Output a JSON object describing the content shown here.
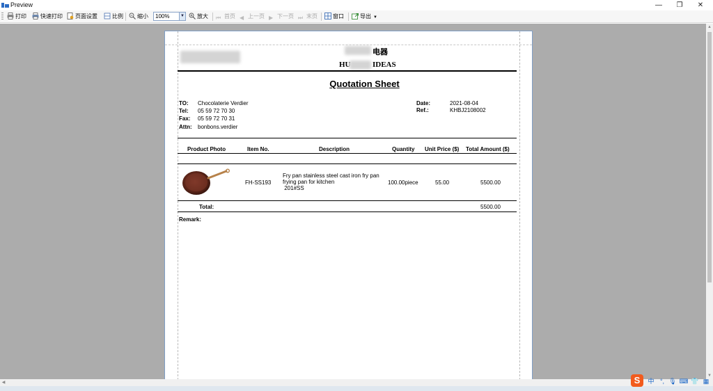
{
  "window": {
    "title": "Preview",
    "minimize_glyph": "—",
    "maximize_glyph": "❐",
    "close_glyph": "✕"
  },
  "toolbar": {
    "print": "打印",
    "quick_print": "快速打印",
    "page_setup": "页面设置",
    "ratio": "比例",
    "zoom_out": "缩小",
    "zoom_value": "100%",
    "zoom_in": "放大",
    "first_page": "首页",
    "prev_page": "上一页",
    "next_page": "下一页",
    "last_page": "末页",
    "window": "窗口",
    "export": "导出"
  },
  "document": {
    "company_cn_suffix": "电器",
    "company_en_prefix": "HU",
    "company_en_suffix": "IDEAS",
    "title": "Quotation Sheet",
    "to_label": "TO:",
    "to_value": "Chocolaterie Verdier",
    "tel_label": "Tel:",
    "tel_value": "05 59 72 70 30",
    "fax_label": "Fax:",
    "fax_value": "05 59 72 70 31",
    "attn_label": "Attn:",
    "attn_value": "bonbons.verdier",
    "date_label": "Date:",
    "date_value": "2021-08-04",
    "ref_label": "Ref.:",
    "ref_value": "KHBJ2108002",
    "table": {
      "headers": [
        "Product Photo",
        "Item No.",
        "Description",
        "Quantity",
        "Unit Price ($)",
        "Total Amount ($)"
      ],
      "rows": [
        {
          "item_no": "FH-SS193",
          "description_line1": "Fry pan stainless steel cast iron fry pan",
          "description_line2": "frying pan for kitchen",
          "description_line3": " 201#SS",
          "quantity": "100.00piece",
          "unit_price": "55.00",
          "total": "5500.00"
        }
      ],
      "total_label": "Total:",
      "total_value": "5500.00"
    },
    "remark_label": "Remark:"
  },
  "tray": {
    "ime": "中",
    "punct": "°,",
    "mic": "🎙",
    "keyboard": "⌨",
    "shirt": "👕",
    "grid": "▦",
    "sogou": "S"
  },
  "colors": {
    "preview_background": "#acacac",
    "page_border": "#7f9fc7",
    "sogou_orange": "#f25b1d",
    "tray_blue": "#1a66c6"
  }
}
